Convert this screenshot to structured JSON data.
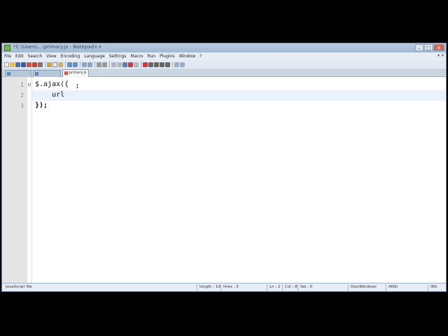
{
  "window": {
    "title": "*C:\\Users\\...\\primary.js - Notepad++"
  },
  "window_controls": {
    "minimize": "–",
    "maximize": "□",
    "close": "✕"
  },
  "menu": [
    "File",
    "Edit",
    "Search",
    "View",
    "Encoding",
    "Language",
    "Settings",
    "Macro",
    "Run",
    "Plugins",
    "Window",
    "?"
  ],
  "mdi_controls": "▾ ✕",
  "tabs": [
    {
      "label": ""
    },
    {
      "label": ""
    },
    {
      "label": "primary.js"
    }
  ],
  "editor": {
    "lines": [
      {
        "number": "1",
        "text": "$.ajax({"
      },
      {
        "number": "2",
        "text": "    url"
      },
      {
        "number": "3",
        "text": "});"
      }
    ],
    "caret_glyph": "I"
  },
  "status": {
    "file_type": "JavaScript file",
    "length": "length : 19",
    "lines": "lines : 3",
    "ln": "Ln : 2",
    "col": "Col : 8",
    "sel": "Sel : 0",
    "eol": "Dos\\Windows",
    "encoding": "ANSI",
    "mode": "INS"
  },
  "colors": {
    "current_line": "#e8f2fe",
    "chrome": "#cfd9e6",
    "active_tab_icon": "#d25a4a"
  }
}
